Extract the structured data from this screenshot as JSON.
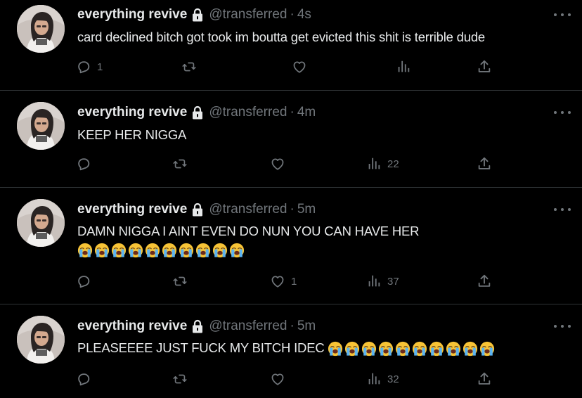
{
  "tweets": [
    {
      "name": "everything revive",
      "handle": "@transferred",
      "time": "4s",
      "text": "card declined bitch got took im boutta get evicted this shit is terrible dude",
      "emojis": [],
      "replies": "1",
      "retweets": "",
      "likes": "",
      "views": ""
    },
    {
      "name": "everything revive",
      "handle": "@transferred",
      "time": "4m",
      "text": "KEEP HER NIGGA",
      "emojis": [],
      "replies": "",
      "retweets": "",
      "likes": "",
      "views": "22"
    },
    {
      "name": "everything revive",
      "handle": "@transferred",
      "time": "5m",
      "text": "DAMN NIGGA I AINT EVEN DO NUN YOU CAN HAVE HER",
      "emojis": [
        "loudly-crying-face",
        "loudly-crying-face",
        "loudly-crying-face",
        "loudly-crying-face",
        "loudly-crying-face",
        "loudly-crying-face",
        "loudly-crying-face",
        "loudly-crying-face",
        "loudly-crying-face",
        "loudly-crying-face"
      ],
      "replies": "",
      "retweets": "",
      "likes": "1",
      "views": "37"
    },
    {
      "name": "everything revive",
      "handle": "@transferred",
      "time": "5m",
      "text": "PLEASEEEE JUST FUCK MY BITCH IDEC",
      "emojis": [
        "loudly-crying-face",
        "loudly-crying-face",
        "loudly-crying-face",
        "loudly-crying-face",
        "loudly-crying-face",
        "loudly-crying-face",
        "loudly-crying-face",
        "loudly-crying-face",
        "loudly-crying-face",
        "loudly-crying-face"
      ],
      "replies": "",
      "retweets": "",
      "likes": "",
      "views": "32"
    }
  ],
  "separator": "·",
  "icons": {
    "reply": "reply-icon",
    "retweet": "retweet-icon",
    "like": "heart-icon",
    "views": "views-icon",
    "share": "share-icon",
    "lock": "lock-icon",
    "more": "more-icon"
  },
  "colors": {
    "background": "#000000",
    "text": "#e7e9ea",
    "muted": "#71767b",
    "divider": "#2f3336"
  }
}
